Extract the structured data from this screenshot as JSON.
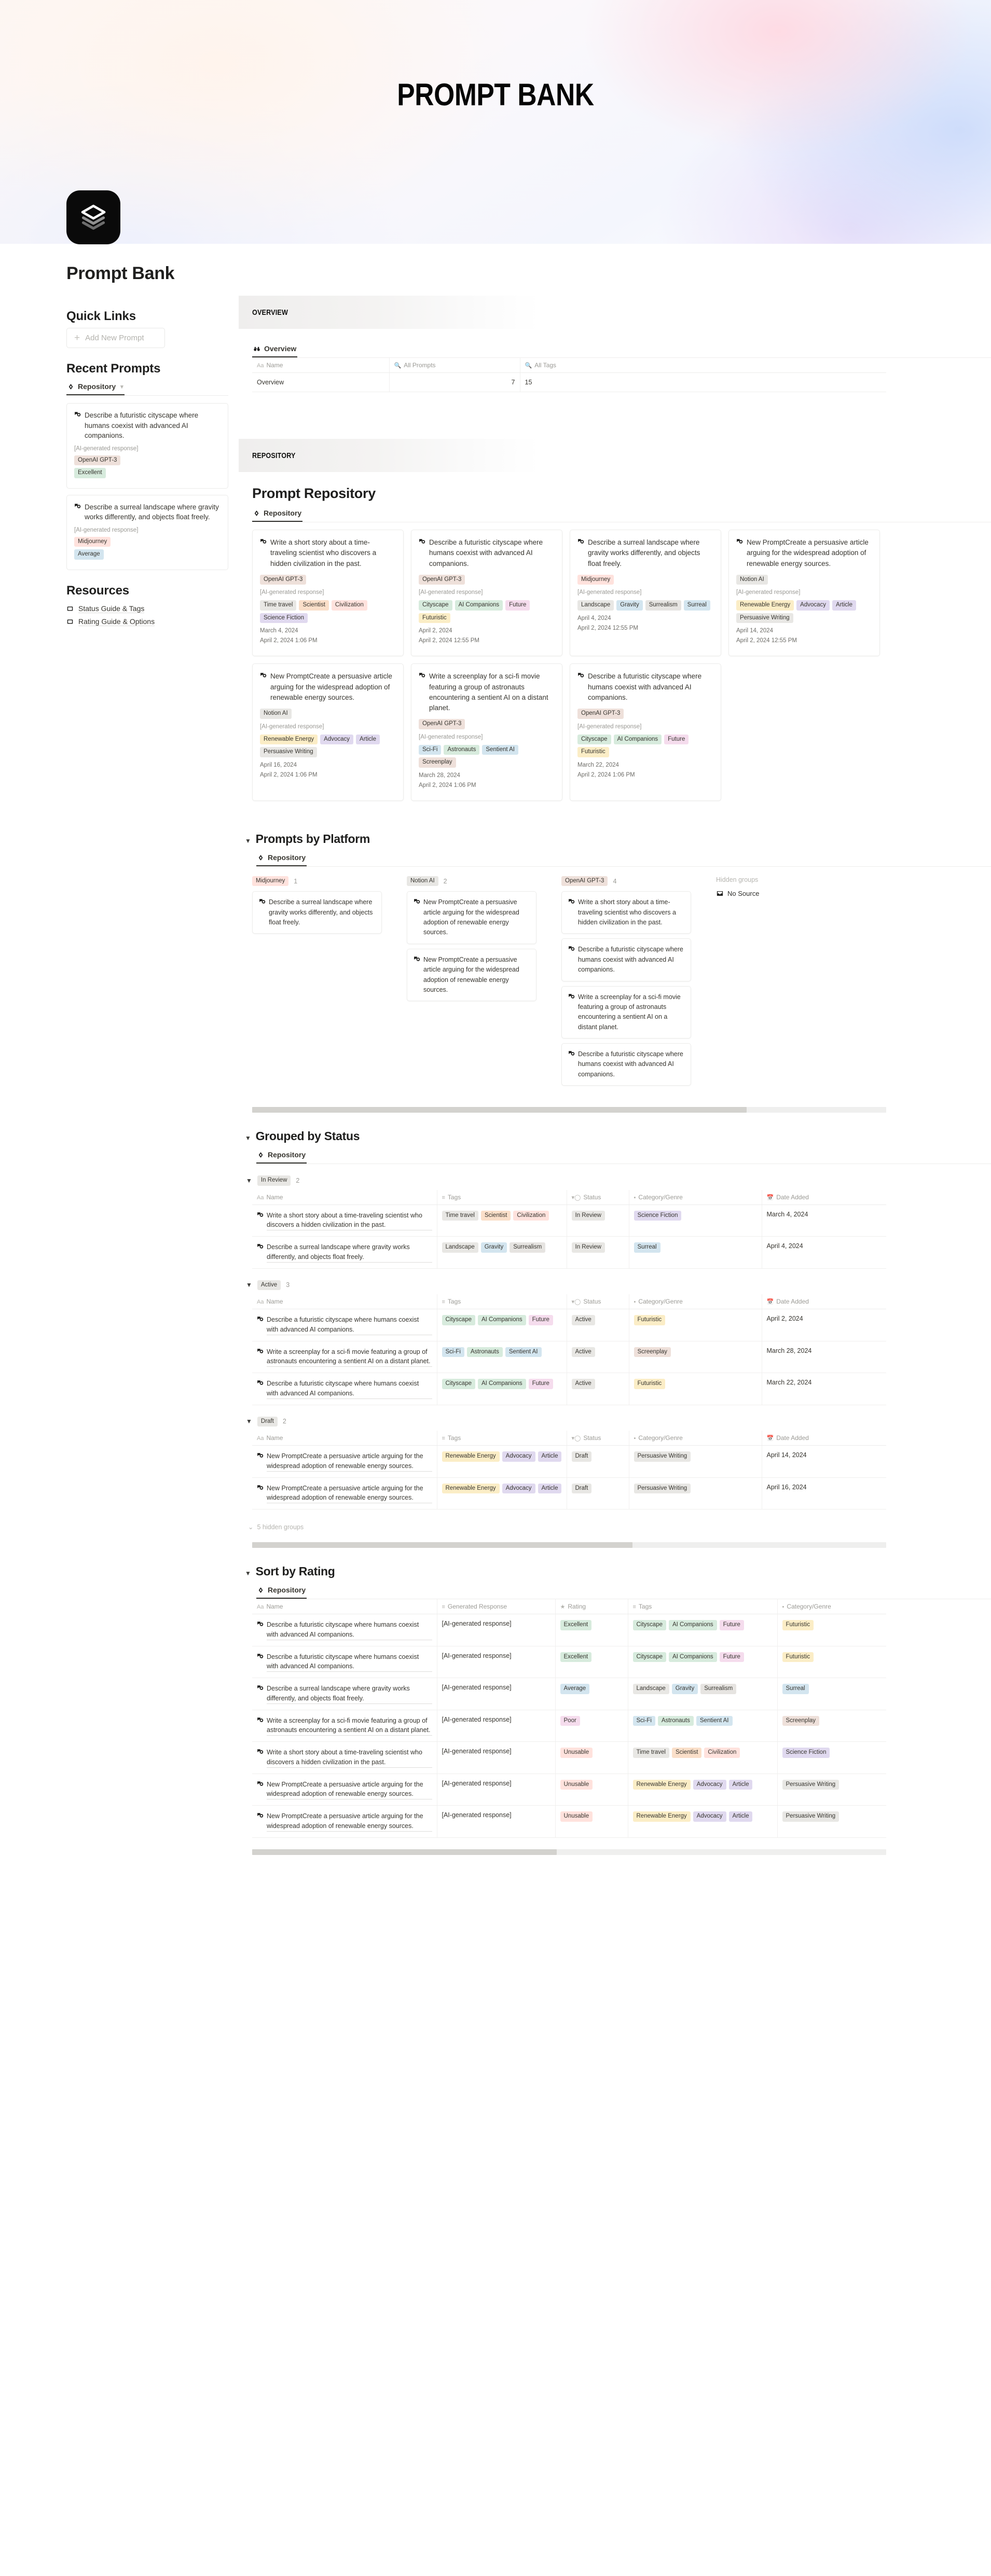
{
  "hero": {
    "title": "PROMPT BANK"
  },
  "page": {
    "title": "Prompt Bank",
    "icon": "layers-stack-icon"
  },
  "sidebar": {
    "quick_links": {
      "heading": "Quick Links",
      "add_button": "Add New Prompt"
    },
    "recent_prompts": {
      "heading": "Recent Prompts",
      "db_tab": "Repository",
      "cards": [
        {
          "title": "Describe a futuristic cityscape where humans coexist with advanced AI companions.",
          "response": "[AI-generated response]",
          "platform": {
            "label": "OpenAI GPT-3",
            "color": "brown"
          },
          "rating": {
            "label": "Excellent",
            "color": "green"
          }
        },
        {
          "title": "Describe a surreal landscape where gravity works differently, and objects float freely.",
          "response": "[AI-generated response]",
          "platform": {
            "label": "Midjourney",
            "color": "red"
          },
          "rating": {
            "label": "Average",
            "color": "blue"
          }
        }
      ]
    },
    "resources": {
      "heading": "Resources",
      "items": [
        {
          "label": "Status Guide & Tags",
          "icon": "page-icon"
        },
        {
          "label": "Rating Guide & Options",
          "icon": "page-icon"
        }
      ]
    }
  },
  "overview_section": {
    "banner": "OVERVIEW",
    "db_tab": "Overview",
    "table": {
      "headers": [
        {
          "label": "Name",
          "icon": "text-aa-icon"
        },
        {
          "label": "All Prompts",
          "icon": "search-icon"
        },
        {
          "label": "All Tags",
          "icon": "search-icon"
        }
      ],
      "rows": [
        {
          "name": "Overview",
          "all_prompts": "7",
          "all_tags": "15"
        }
      ]
    }
  },
  "repository_section": {
    "banner": "REPOSITORY",
    "title": "Prompt Repository",
    "db_tab": "Repository",
    "cards": [
      {
        "title": "Write a short story about a time-traveling scientist who discovers a hidden civilization in the past.",
        "platform": {
          "label": "OpenAI GPT-3",
          "color": "brown"
        },
        "response": "[AI-generated response]",
        "tags": [
          {
            "label": "Time travel",
            "color": "default"
          },
          {
            "label": "Scientist",
            "color": "orange"
          },
          {
            "label": "Civilization",
            "color": "red"
          },
          {
            "label": "Science Fiction",
            "color": "purple"
          }
        ],
        "date_added": "March 4, 2024",
        "timestamp": "April 2, 2024 1:06 PM"
      },
      {
        "title": "Describe a futuristic cityscape where humans coexist with advanced AI companions.",
        "platform": {
          "label": "OpenAI GPT-3",
          "color": "brown"
        },
        "response": "[AI-generated response]",
        "tags": [
          {
            "label": "Cityscape",
            "color": "green"
          },
          {
            "label": "AI Companions",
            "color": "green"
          },
          {
            "label": "Future",
            "color": "pink"
          },
          {
            "label": "Futuristic",
            "color": "yellow"
          }
        ],
        "date_added": "April 2, 2024",
        "timestamp": "April 2, 2024 12:55 PM"
      },
      {
        "title": "Describe a surreal landscape where gravity works differently, and objects float freely.",
        "platform": {
          "label": "Midjourney",
          "color": "red"
        },
        "response": "[AI-generated response]",
        "tags": [
          {
            "label": "Landscape",
            "color": "default"
          },
          {
            "label": "Gravity",
            "color": "blue"
          },
          {
            "label": "Surrealism",
            "color": "gray"
          },
          {
            "label": "Surreal",
            "color": "blue"
          }
        ],
        "date_added": "April 4, 2024",
        "timestamp": "April 2, 2024 12:55 PM"
      },
      {
        "title": "New PromptCreate a persuasive article arguing for the widespread adoption of renewable energy sources.",
        "platform": {
          "label": "Notion AI",
          "color": "default"
        },
        "response": "[AI-generated response]",
        "tags": [
          {
            "label": "Renewable Energy",
            "color": "yellow"
          },
          {
            "label": "Advocacy",
            "color": "purple"
          },
          {
            "label": "Article",
            "color": "purple"
          },
          {
            "label": "Persuasive Writing",
            "color": "default"
          }
        ],
        "date_added": "April 14, 2024",
        "timestamp": "April 2, 2024 12:55 PM"
      },
      {
        "title": "New PromptCreate a persuasive article arguing for the widespread adoption of renewable energy sources.",
        "platform": {
          "label": "Notion AI",
          "color": "default"
        },
        "response": "[AI-generated response]",
        "tags": [
          {
            "label": "Renewable Energy",
            "color": "yellow"
          },
          {
            "label": "Advocacy",
            "color": "purple"
          },
          {
            "label": "Article",
            "color": "purple"
          },
          {
            "label": "Persuasive Writing",
            "color": "default"
          }
        ],
        "date_added": "April 16, 2024",
        "timestamp": "April 2, 2024 1:06 PM"
      },
      {
        "title": "Write a screenplay for a sci-fi movie featuring a group of astronauts encountering a sentient AI on a distant planet.",
        "platform": {
          "label": "OpenAI GPT-3",
          "color": "brown"
        },
        "response": "[AI-generated response]",
        "tags": [
          {
            "label": "Sci-Fi",
            "color": "blue"
          },
          {
            "label": "Astronauts",
            "color": "green"
          },
          {
            "label": "Sentient AI",
            "color": "blue"
          },
          {
            "label": "Screenplay",
            "color": "brown"
          }
        ],
        "date_added": "March 28, 2024",
        "timestamp": "April 2, 2024 1:06 PM"
      },
      {
        "title": "Describe a futuristic cityscape where humans coexist with advanced AI companions.",
        "platform": {
          "label": "OpenAI GPT-3",
          "color": "brown"
        },
        "response": "[AI-generated response]",
        "tags": [
          {
            "label": "Cityscape",
            "color": "green"
          },
          {
            "label": "AI Companions",
            "color": "green"
          },
          {
            "label": "Future",
            "color": "pink"
          },
          {
            "label": "Futuristic",
            "color": "yellow"
          }
        ],
        "date_added": "March 22, 2024",
        "timestamp": "April 2, 2024 1:06 PM"
      }
    ]
  },
  "platform_section": {
    "title": "Prompts by Platform",
    "db_tab": "Repository",
    "hidden_groups_label": "Hidden groups",
    "no_source_label": "No Source",
    "columns": [
      {
        "label": "Midjourney",
        "color": "red",
        "count": "1",
        "cards": [
          "Describe a surreal landscape where gravity works differently, and objects float freely."
        ]
      },
      {
        "label": "Notion AI",
        "color": "default",
        "count": "2",
        "cards": [
          "New PromptCreate a persuasive article arguing for the widespread adoption of renewable energy sources.",
          "New PromptCreate a persuasive article arguing for the widespread adoption of renewable energy sources."
        ]
      },
      {
        "label": "OpenAI GPT-3",
        "color": "brown",
        "count": "4",
        "cards": [
          "Write a short story about a time-traveling scientist who discovers a hidden civilization in the past.",
          "Describe a futuristic cityscape where humans coexist with advanced AI companions.",
          "Write a screenplay for a sci-fi movie featuring a group of astronauts encountering a sentient AI on a distant planet.",
          "Describe a futuristic cityscape where humans coexist with advanced AI companions."
        ]
      }
    ]
  },
  "status_section": {
    "title": "Grouped by Status",
    "db_tab": "Repository",
    "headers": [
      {
        "label": "Name",
        "icon": "text-aa-icon"
      },
      {
        "label": "Tags",
        "icon": "multi-select-icon"
      },
      {
        "label": "Status",
        "icon": "status-icon"
      },
      {
        "label": "Category/Genre",
        "icon": "select-icon"
      },
      {
        "label": "Date Added",
        "icon": "calendar-icon"
      }
    ],
    "hidden_groups": "5 hidden groups",
    "groups": [
      {
        "label": "In Review",
        "color": "default",
        "count": "2",
        "rows": [
          {
            "name": "Write a short story about a time-traveling scientist who discovers a hidden civilization in the past.",
            "tags": [
              {
                "label": "Time travel",
                "color": "default"
              },
              {
                "label": "Scientist",
                "color": "orange"
              },
              {
                "label": "Civilization",
                "color": "red"
              }
            ],
            "status": {
              "label": "In Review",
              "color": "default"
            },
            "category": {
              "label": "Science Fiction",
              "color": "purple"
            },
            "date": "March 4, 2024"
          },
          {
            "name": "Describe a surreal landscape where gravity works differently, and objects float freely.",
            "tags": [
              {
                "label": "Landscape",
                "color": "default"
              },
              {
                "label": "Gravity",
                "color": "blue"
              },
              {
                "label": "Surrealism",
                "color": "gray"
              }
            ],
            "status": {
              "label": "In Review",
              "color": "default"
            },
            "category": {
              "label": "Surreal",
              "color": "blue"
            },
            "date": "April 4, 2024"
          }
        ]
      },
      {
        "label": "Active",
        "color": "default",
        "count": "3",
        "rows": [
          {
            "name": "Describe a futuristic cityscape where humans coexist with advanced AI companions.",
            "tags": [
              {
                "label": "Cityscape",
                "color": "green"
              },
              {
                "label": "AI Companions",
                "color": "green"
              },
              {
                "label": "Future",
                "color": "pink"
              }
            ],
            "status": {
              "label": "Active",
              "color": "default"
            },
            "category": {
              "label": "Futuristic",
              "color": "yellow"
            },
            "date": "April 2, 2024"
          },
          {
            "name": "Write a screenplay for a sci-fi movie featuring a group of astronauts encountering a sentient AI on a distant planet.",
            "tags": [
              {
                "label": "Sci-Fi",
                "color": "blue"
              },
              {
                "label": "Astronauts",
                "color": "green"
              },
              {
                "label": "Sentient AI",
                "color": "blue"
              }
            ],
            "status": {
              "label": "Active",
              "color": "default"
            },
            "category": {
              "label": "Screenplay",
              "color": "brown"
            },
            "date": "March 28, 2024"
          },
          {
            "name": "Describe a futuristic cityscape where humans coexist with advanced AI companions.",
            "tags": [
              {
                "label": "Cityscape",
                "color": "green"
              },
              {
                "label": "AI Companions",
                "color": "green"
              },
              {
                "label": "Future",
                "color": "pink"
              }
            ],
            "status": {
              "label": "Active",
              "color": "default"
            },
            "category": {
              "label": "Futuristic",
              "color": "yellow"
            },
            "date": "March 22, 2024"
          }
        ]
      },
      {
        "label": "Draft",
        "color": "default",
        "count": "2",
        "rows": [
          {
            "name": "New PromptCreate a persuasive article arguing for the widespread adoption of renewable energy sources.",
            "tags": [
              {
                "label": "Renewable Energy",
                "color": "yellow"
              },
              {
                "label": "Advocacy",
                "color": "purple"
              },
              {
                "label": "Article",
                "color": "purple"
              }
            ],
            "status": {
              "label": "Draft",
              "color": "default"
            },
            "category": {
              "label": "Persuasive Writing",
              "color": "default"
            },
            "date": "April 14, 2024"
          },
          {
            "name": "New PromptCreate a persuasive article arguing for the widespread adoption of renewable energy sources.",
            "tags": [
              {
                "label": "Renewable Energy",
                "color": "yellow"
              },
              {
                "label": "Advocacy",
                "color": "purple"
              },
              {
                "label": "Article",
                "color": "purple"
              }
            ],
            "status": {
              "label": "Draft",
              "color": "default"
            },
            "category": {
              "label": "Persuasive Writing",
              "color": "default"
            },
            "date": "April 16, 2024"
          }
        ]
      }
    ]
  },
  "rating_section": {
    "title": "Sort by Rating",
    "db_tab": "Repository",
    "headers": [
      {
        "label": "Name",
        "icon": "text-aa-icon"
      },
      {
        "label": "Generated Response",
        "icon": "text-lines-icon"
      },
      {
        "label": "Rating",
        "icon": "star-icon"
      },
      {
        "label": "Tags",
        "icon": "multi-select-icon"
      },
      {
        "label": "Category/Genre",
        "icon": "select-icon"
      }
    ],
    "rows": [
      {
        "name": "Describe a futuristic cityscape where humans coexist with advanced AI companions.",
        "response": "[AI-generated response]",
        "rating": {
          "label": "Excellent",
          "color": "green"
        },
        "tags": [
          {
            "label": "Cityscape",
            "color": "green"
          },
          {
            "label": "AI Companions",
            "color": "green"
          },
          {
            "label": "Future",
            "color": "pink"
          }
        ],
        "category": {
          "label": "Futuristic",
          "color": "yellow"
        }
      },
      {
        "name": "Describe a futuristic cityscape where humans coexist with advanced AI companions.",
        "response": "[AI-generated response]",
        "rating": {
          "label": "Excellent",
          "color": "green"
        },
        "tags": [
          {
            "label": "Cityscape",
            "color": "green"
          },
          {
            "label": "AI Companions",
            "color": "green"
          },
          {
            "label": "Future",
            "color": "pink"
          }
        ],
        "category": {
          "label": "Futuristic",
          "color": "yellow"
        }
      },
      {
        "name": "Describe a surreal landscape where gravity works differently, and objects float freely.",
        "response": "[AI-generated response]",
        "rating": {
          "label": "Average",
          "color": "blue"
        },
        "tags": [
          {
            "label": "Landscape",
            "color": "default"
          },
          {
            "label": "Gravity",
            "color": "blue"
          },
          {
            "label": "Surrealism",
            "color": "gray"
          }
        ],
        "category": {
          "label": "Surreal",
          "color": "blue"
        }
      },
      {
        "name": "Write a screenplay for a sci-fi movie featuring a group of astronauts encountering a sentient AI on a distant planet.",
        "response": "[AI-generated response]",
        "rating": {
          "label": "Poor",
          "color": "pink"
        },
        "tags": [
          {
            "label": "Sci-Fi",
            "color": "blue"
          },
          {
            "label": "Astronauts",
            "color": "green"
          },
          {
            "label": "Sentient AI",
            "color": "blue"
          }
        ],
        "category": {
          "label": "Screenplay",
          "color": "brown"
        }
      },
      {
        "name": "Write a short story about a time-traveling scientist who discovers a hidden civilization in the past.",
        "response": "[AI-generated response]",
        "rating": {
          "label": "Unusable",
          "color": "red"
        },
        "tags": [
          {
            "label": "Time travel",
            "color": "default"
          },
          {
            "label": "Scientist",
            "color": "orange"
          },
          {
            "label": "Civilization",
            "color": "red"
          }
        ],
        "category": {
          "label": "Science Fiction",
          "color": "purple"
        }
      },
      {
        "name": "New PromptCreate a persuasive article arguing for the widespread adoption of renewable energy sources.",
        "response": "[AI-generated response]",
        "rating": {
          "label": "Unusable",
          "color": "red"
        },
        "tags": [
          {
            "label": "Renewable Energy",
            "color": "yellow"
          },
          {
            "label": "Advocacy",
            "color": "purple"
          },
          {
            "label": "Article",
            "color": "purple"
          }
        ],
        "category": {
          "label": "Persuasive Writing",
          "color": "default"
        }
      },
      {
        "name": "New PromptCreate a persuasive article arguing for the widespread adoption of renewable energy sources.",
        "response": "[AI-generated response]",
        "rating": {
          "label": "Unusable",
          "color": "red"
        },
        "tags": [
          {
            "label": "Renewable Energy",
            "color": "yellow"
          },
          {
            "label": "Advocacy",
            "color": "purple"
          },
          {
            "label": "Article",
            "color": "purple"
          }
        ],
        "category": {
          "label": "Persuasive Writing",
          "color": "default"
        }
      }
    ]
  }
}
